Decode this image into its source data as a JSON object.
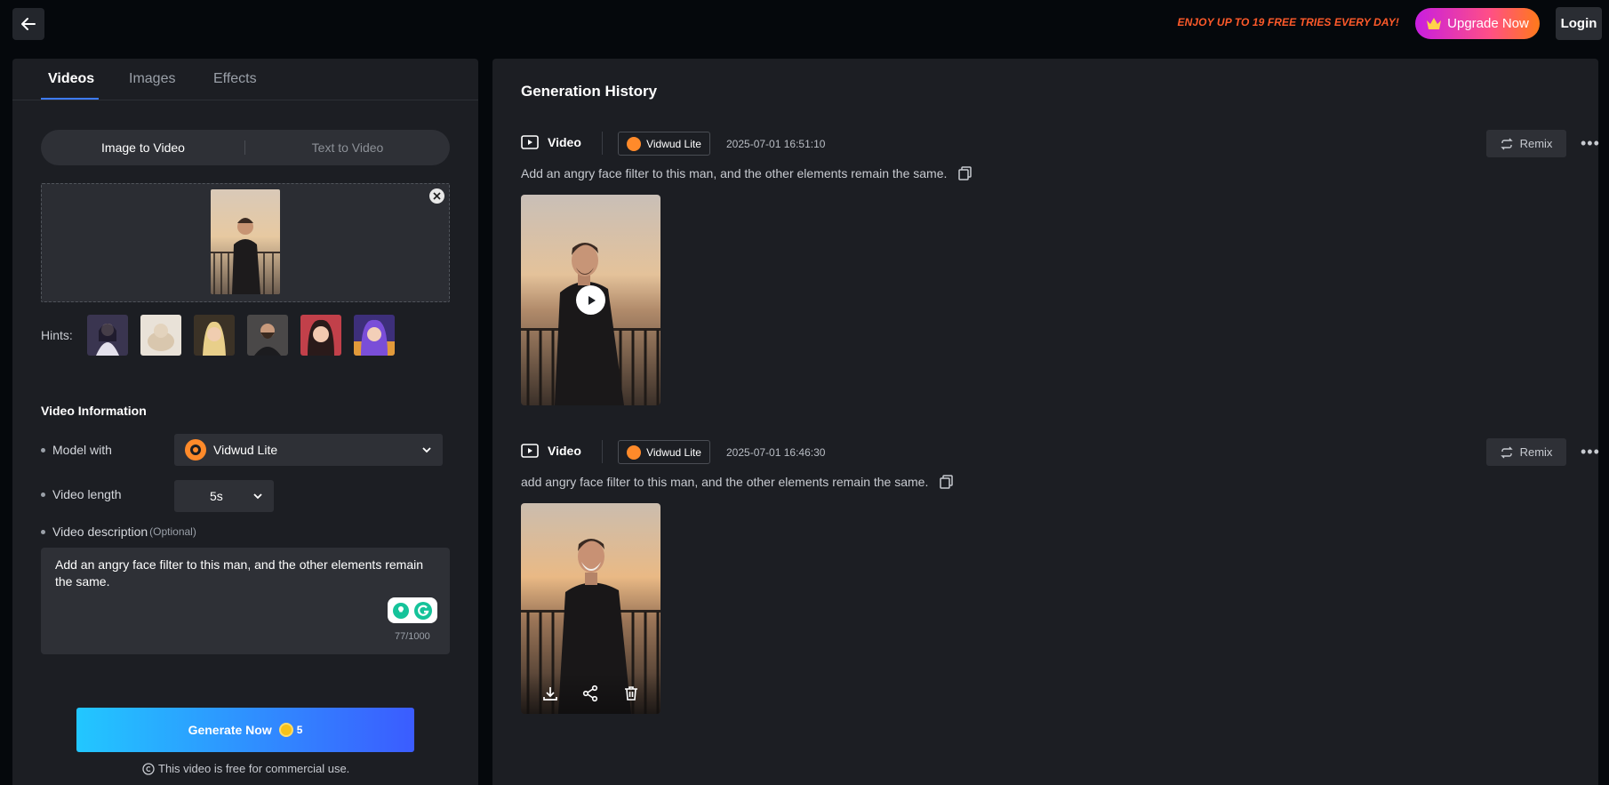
{
  "header": {
    "back_icon": "arrow-left-icon",
    "promo_text": "ENJOY UP TO 19 FREE TRIES EVERY DAY!",
    "upgrade_label": "Upgrade Now",
    "upgrade_icon": "crown-icon",
    "login_label": "Login"
  },
  "left_panel": {
    "tabs": [
      {
        "label": "Videos",
        "active": true
      },
      {
        "label": "Images",
        "active": false
      },
      {
        "label": "Effects",
        "active": false
      }
    ],
    "mode_toggle": {
      "options": [
        "Image to Video",
        "Text to Video"
      ],
      "selected": "Image to Video"
    },
    "upload": {
      "has_image": true,
      "remove_icon": "close-circle-icon"
    },
    "hints_label": "Hints:",
    "hints_count": 6,
    "video_information": {
      "title": "Video Information",
      "model_label": "Model with",
      "model_value": "Vidwud Lite",
      "length_label": "Video length",
      "length_value": "5s",
      "description_label": "Video description",
      "description_optional": "(Optional)",
      "description_value": "Add an angry face filter to this man, and the other elements remain the same.",
      "char_count": "77/1000"
    },
    "generate": {
      "label": "Generate Now",
      "cost": "5",
      "coin_icon": "coin-icon"
    },
    "license_note": "This video is free for commercial use.",
    "license_icon": "copyright-icon"
  },
  "history": {
    "title": "Generation History",
    "entries": [
      {
        "type_label": "Video",
        "model": "Vidwud Lite",
        "timestamp": "2025-07-01 16:51:10",
        "remix_label": "Remix",
        "prompt": "Add an angry face filter to this man, and the other elements remain the same.",
        "show_play": true
      },
      {
        "type_label": "Video",
        "model": "Vidwud Lite",
        "timestamp": "2025-07-01 16:46:30",
        "remix_label": "Remix",
        "prompt": "add angry face filter to this man, and the other elements remain the same.",
        "show_play": false
      }
    ]
  },
  "colors": {
    "accent_blue": "#3d7bff",
    "promo": "#ff5a2a",
    "panel_bg": "#1c1e23",
    "page_bg": "#05080c"
  }
}
